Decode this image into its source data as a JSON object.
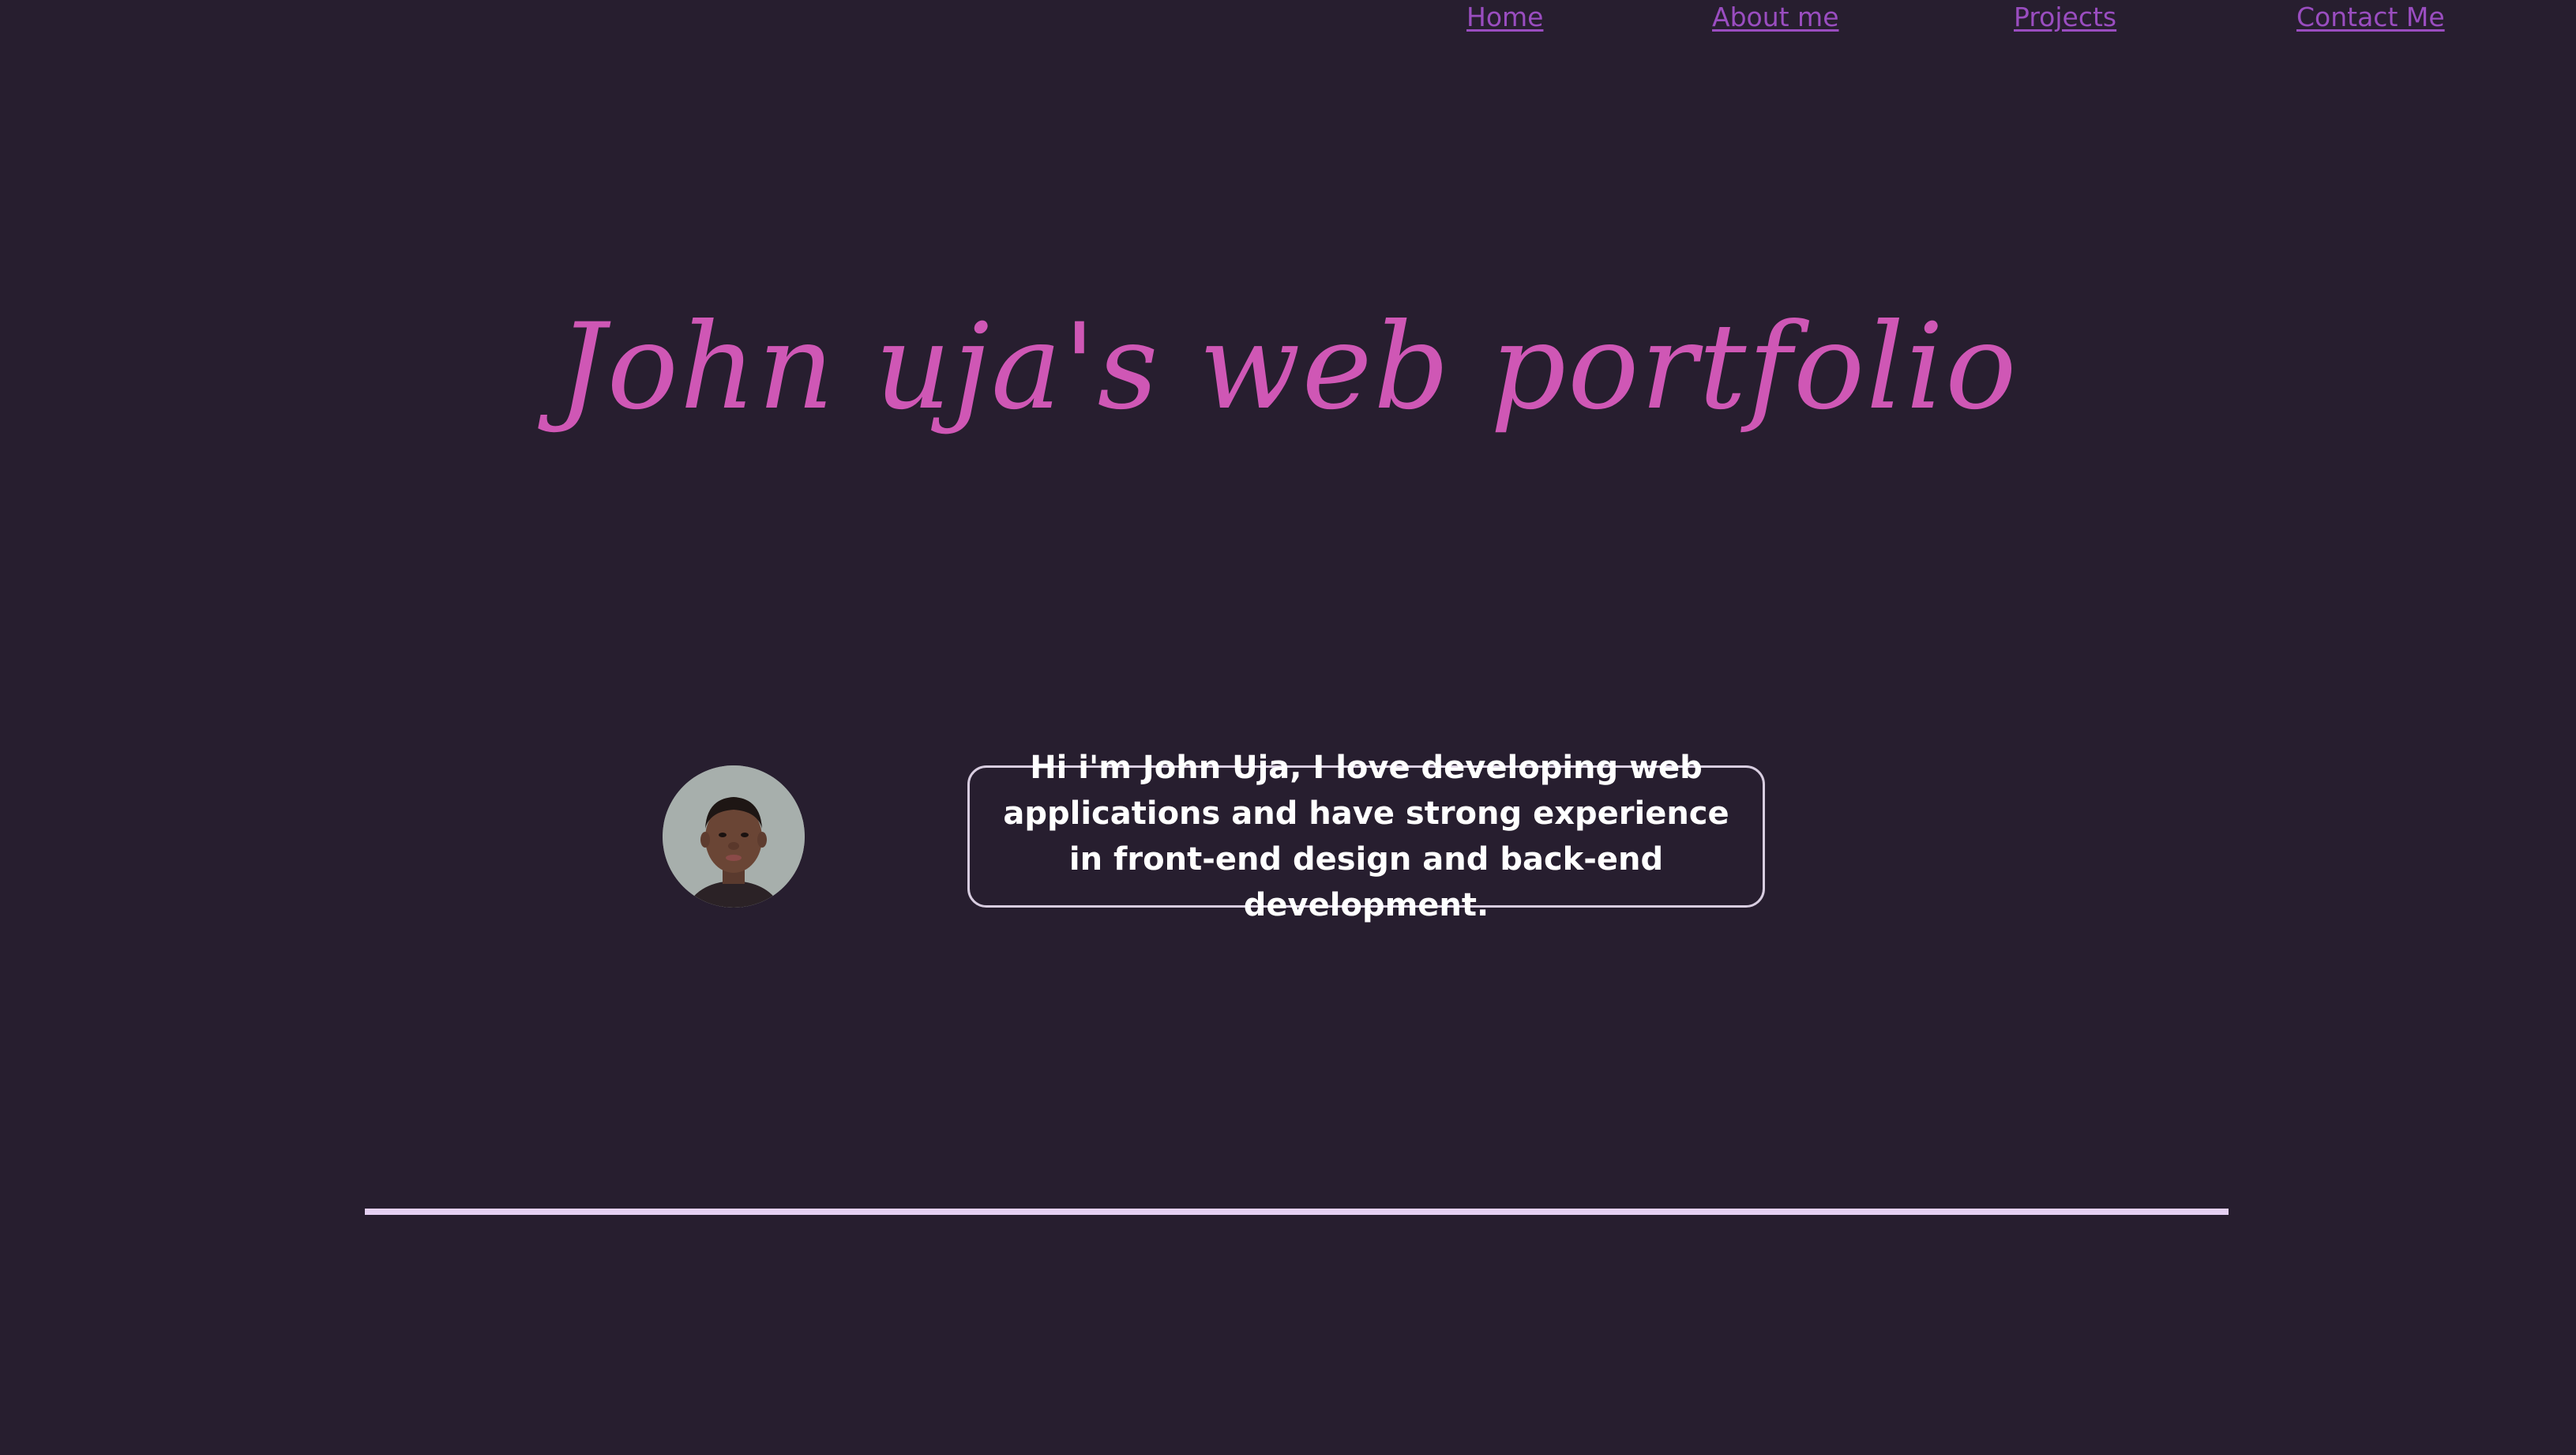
{
  "nav": {
    "items": [
      {
        "label": "Home"
      },
      {
        "label": "About me"
      },
      {
        "label": "Projects"
      },
      {
        "label": "Contact Me"
      }
    ]
  },
  "hero": {
    "title": "John uja's web portfolio"
  },
  "intro": {
    "text": "Hi i'm John Uja, I love developing web applications and have strong experience in front-end design and back-end development."
  },
  "colors": {
    "background": "#271e2f",
    "nav_link": "#9a4dc0",
    "title": "#cf57b5",
    "intro_text": "#ffffff",
    "divider": "#e5d0f3"
  },
  "icons": {
    "avatar": "profile-photo"
  }
}
